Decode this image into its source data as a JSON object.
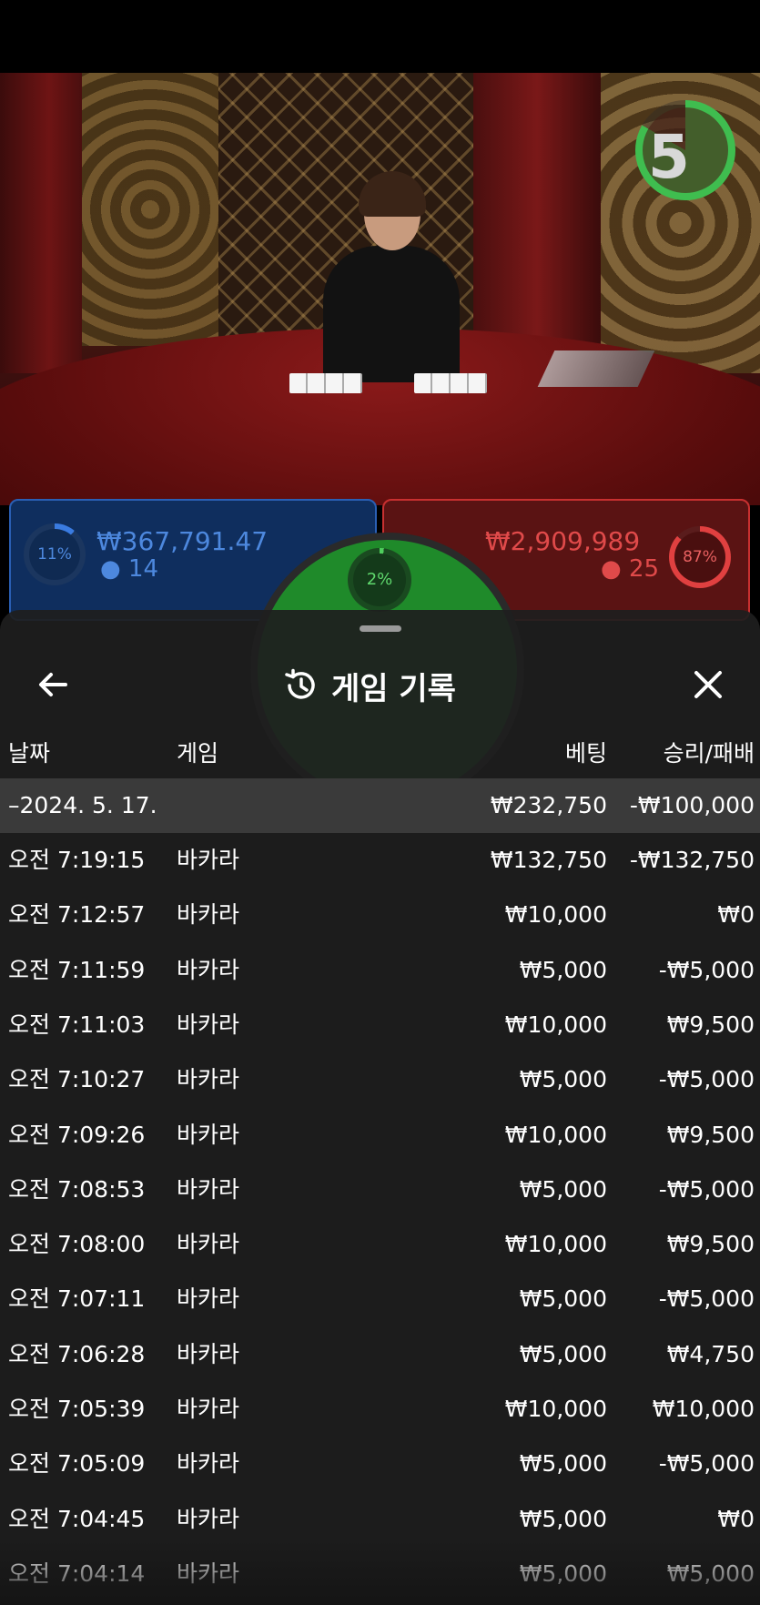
{
  "stream": {
    "countdown": "5",
    "player_bet": {
      "pct": "11%",
      "amount": "₩367,791.47",
      "players": "14"
    },
    "banker_bet": {
      "pct": "87%",
      "amount": "₩2,909,989",
      "players": "25"
    },
    "tie_bet": {
      "pct": "2%"
    }
  },
  "sheet": {
    "title": "게임 기록",
    "columns": {
      "date": "날짜",
      "game": "게임",
      "bet": "베팅",
      "result": "승리/패배"
    },
    "date_group": {
      "date": "–2024. 5. 17.",
      "bet": "₩232,750",
      "result": "-₩100,000"
    },
    "rows": [
      {
        "time": "오전 7:19:15",
        "game": "바카라",
        "bet": "₩132,750",
        "result": "-₩132,750"
      },
      {
        "time": "오전 7:12:57",
        "game": "바카라",
        "bet": "₩10,000",
        "result": "₩0"
      },
      {
        "time": "오전 7:11:59",
        "game": "바카라",
        "bet": "₩5,000",
        "result": "-₩5,000"
      },
      {
        "time": "오전 7:11:03",
        "game": "바카라",
        "bet": "₩10,000",
        "result": "₩9,500"
      },
      {
        "time": "오전 7:10:27",
        "game": "바카라",
        "bet": "₩5,000",
        "result": "-₩5,000"
      },
      {
        "time": "오전 7:09:26",
        "game": "바카라",
        "bet": "₩10,000",
        "result": "₩9,500"
      },
      {
        "time": "오전 7:08:53",
        "game": "바카라",
        "bet": "₩5,000",
        "result": "-₩5,000"
      },
      {
        "time": "오전 7:08:00",
        "game": "바카라",
        "bet": "₩10,000",
        "result": "₩9,500"
      },
      {
        "time": "오전 7:07:11",
        "game": "바카라",
        "bet": "₩5,000",
        "result": "-₩5,000"
      },
      {
        "time": "오전 7:06:28",
        "game": "바카라",
        "bet": "₩5,000",
        "result": "₩4,750"
      },
      {
        "time": "오전 7:05:39",
        "game": "바카라",
        "bet": "₩10,000",
        "result": "₩10,000"
      },
      {
        "time": "오전 7:05:09",
        "game": "바카라",
        "bet": "₩5,000",
        "result": "-₩5,000"
      },
      {
        "time": "오전 7:04:45",
        "game": "바카라",
        "bet": "₩5,000",
        "result": "₩0"
      },
      {
        "time": "오전 7:04:14",
        "game": "바카라",
        "bet": "₩5,000",
        "result": "₩5,000"
      }
    ]
  },
  "colors": {
    "player": "#2a5fb4",
    "banker": "#c83030",
    "tie": "#1f8a2a",
    "timer": "#3fbd4f"
  }
}
